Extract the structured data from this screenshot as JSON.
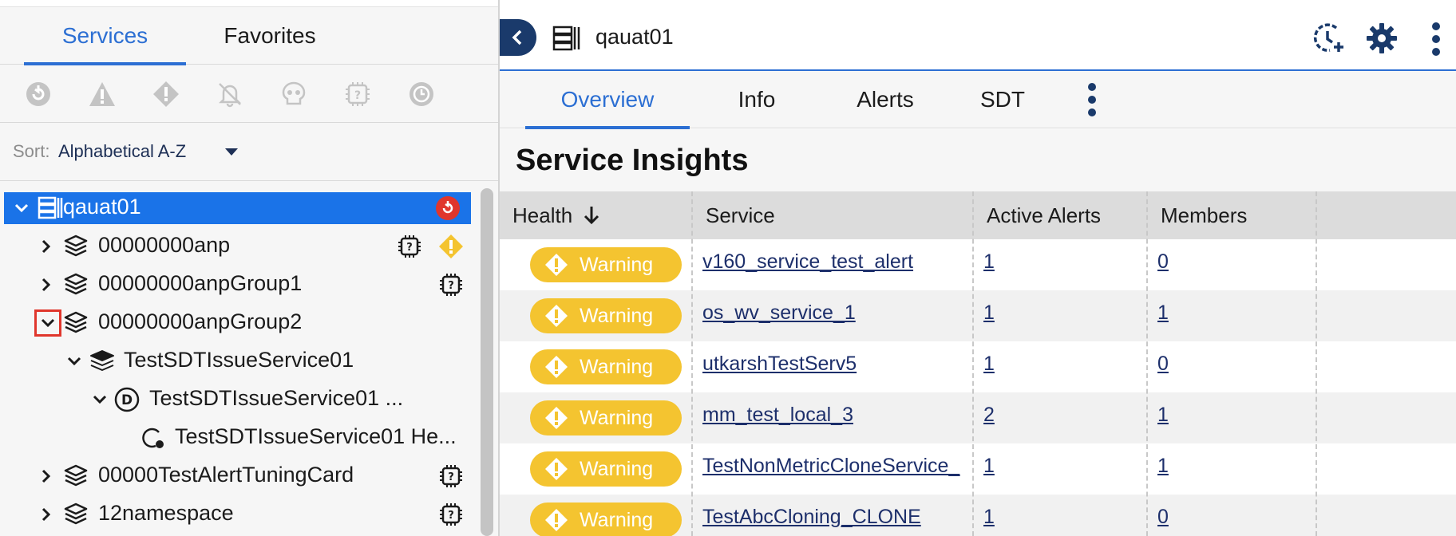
{
  "left": {
    "tabs": [
      {
        "label": "Services"
      },
      {
        "label": "Favorites"
      }
    ],
    "filters": [
      "dead-icon",
      "warning-triangle-icon",
      "error-diamond-icon",
      "alert-muted-icon",
      "skull-icon",
      "chip-unknown-icon",
      "sdt-clock-icon"
    ],
    "sort": {
      "label": "Sort:",
      "value": "Alphabetical A-Z"
    },
    "tree": [
      {
        "label": "qauat01",
        "selected": true
      },
      {
        "label": "00000000anp"
      },
      {
        "label": "00000000anpGroup1"
      },
      {
        "label": "00000000anpGroup2"
      },
      {
        "label": "TestSDTIssueService01"
      },
      {
        "label": "TestSDTIssueService01 ..."
      },
      {
        "label": "TestSDTIssueService01 He..."
      },
      {
        "label": "00000TestAlertTuningCard"
      },
      {
        "label": "12namespace"
      }
    ]
  },
  "right": {
    "title": "qauat01",
    "tabs": [
      {
        "label": "Overview"
      },
      {
        "label": "Info"
      },
      {
        "label": "Alerts"
      },
      {
        "label": "SDT"
      }
    ],
    "section_title": "Service Insights",
    "columns": [
      "Health",
      "Service",
      "Active Alerts",
      "Members"
    ],
    "rows": [
      {
        "health": "Warning",
        "service": "v160_service_test_alert",
        "alerts": "1",
        "members": "0"
      },
      {
        "health": "Warning",
        "service": "os_wv_service_1",
        "alerts": "1",
        "members": "1"
      },
      {
        "health": "Warning",
        "service": "utkarshTestServ5",
        "alerts": "1",
        "members": "0"
      },
      {
        "health": "Warning",
        "service": "mm_test_local_3",
        "alerts": "2",
        "members": "1"
      },
      {
        "health": "Warning",
        "service": "TestNonMetricCloneService_",
        "alerts": "1",
        "members": "1"
      },
      {
        "health": "Warning",
        "service": "TestAbcCloning_CLONE",
        "alerts": "1",
        "members": "0"
      }
    ]
  },
  "colors": {
    "accent": "#2c6fd3",
    "selected": "#1a73e8",
    "warning": "#f4c430",
    "dark_navy": "#1a3a6b"
  }
}
